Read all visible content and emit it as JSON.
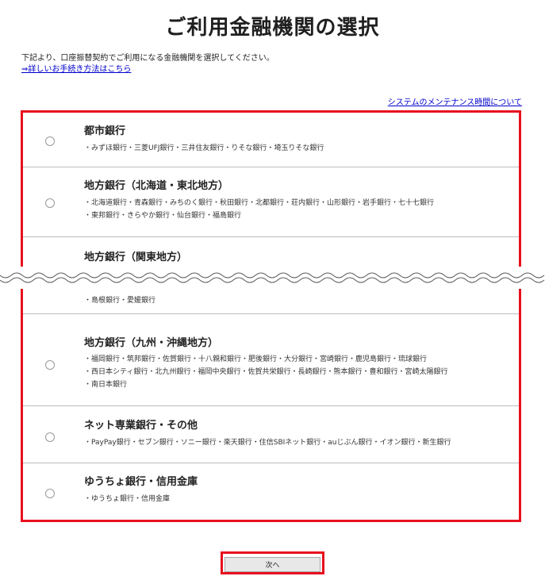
{
  "page_title": "ご利用金融機関の選択",
  "intro": {
    "text": "下記より、口座振替契約でご利用になる金融機関を選択してください。",
    "link": "⇒詳しいお手続き方法はこちら"
  },
  "maintenance_link": "システムのメンテナンス時間について",
  "categories": [
    {
      "title": "都市銀行",
      "banks": [
        "・みずほ銀行・三菱UFJ銀行・三井住友銀行・りそな銀行・埼玉りそな銀行"
      ]
    },
    {
      "title": "地方銀行（北海道・東北地方）",
      "banks": [
        "・北海道銀行・青森銀行・みちのく銀行・秋田銀行・北都銀行・荘内銀行・山形銀行・岩手銀行・七十七銀行",
        "・東邦銀行・きらやか銀行・仙台銀行・福島銀行"
      ]
    },
    {
      "title": "地方銀行（関東地方）",
      "banks": []
    },
    {
      "title": "",
      "banks": [
        "・島根銀行・愛媛銀行"
      ]
    },
    {
      "title": "地方銀行（九州・沖縄地方）",
      "banks": [
        "・福岡銀行・筑邦銀行・佐賀銀行・十八親和銀行・肥後銀行・大分銀行・宮崎銀行・鹿児島銀行・琉球銀行",
        "・西日本シティ銀行・北九州銀行・福岡中央銀行・佐賀共栄銀行・長崎銀行・熊本銀行・豊和銀行・宮崎太陽銀行",
        "・南日本銀行"
      ]
    },
    {
      "title": "ネット専業銀行・その他",
      "banks": [
        "・PayPay銀行・セブン銀行・ソニー銀行・楽天銀行・住信SBIネット銀行・auじぶん銀行・イオン銀行・新生銀行"
      ]
    },
    {
      "title": "ゆうちょ銀行・信用金庫",
      "banks": [
        "・ゆうちょ銀行・信用金庫"
      ]
    }
  ],
  "next_button": "次へ",
  "colors": {
    "highlight": "#e8101e",
    "link": "#0000cc"
  }
}
